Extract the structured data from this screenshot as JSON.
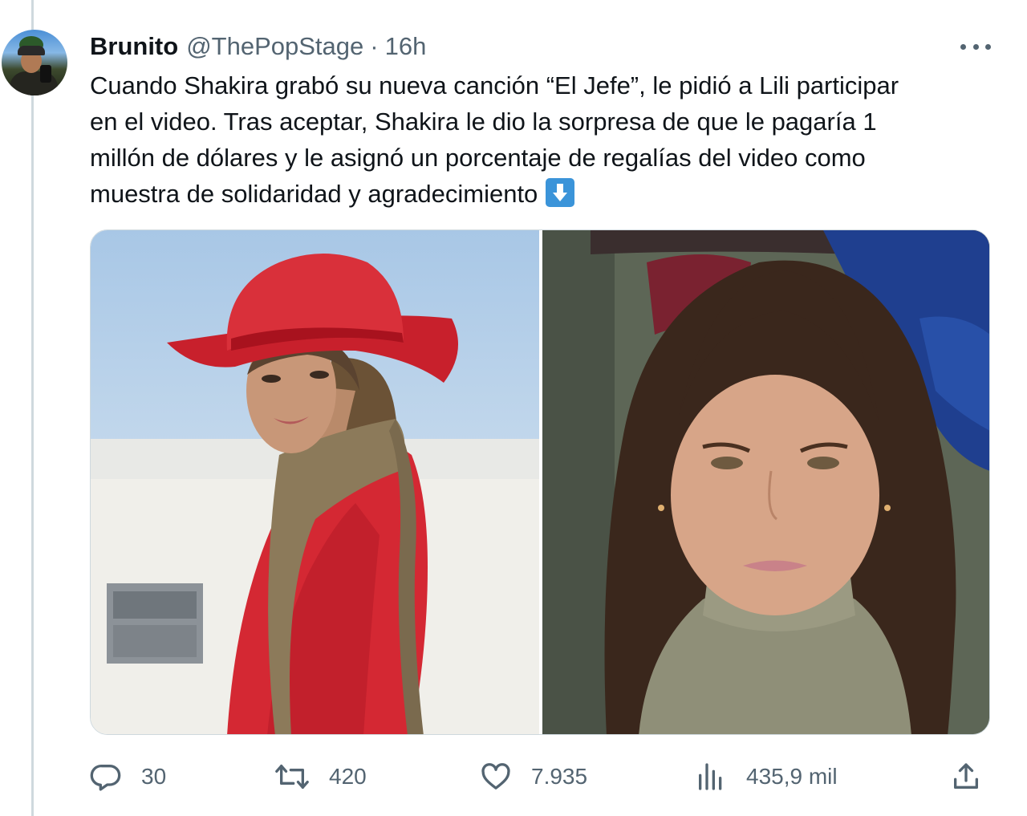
{
  "tweet": {
    "display_name": "Brunito",
    "handle": "@ThePopStage",
    "separator": "·",
    "time": "16h",
    "text_lines": [
      "Cuando Shakira grabó su nueva canción “El Jefe”, le pidió a Lili participar",
      "en el video. Tras aceptar, Shakira le dio la sorpresa de que le pagaría 1",
      "millón de dólares y le asignó un porcentaje de regalías del video como",
      "muestra de solidaridad y agradecimiento"
    ],
    "text_emoji": "arrow-down-emoji",
    "media": [
      {
        "icon": "photo-woman-red-cowboy-hat"
      },
      {
        "icon": "photo-woman-portrait"
      }
    ]
  },
  "actions": {
    "replies": {
      "icon": "reply-icon",
      "count": "30"
    },
    "retweets": {
      "icon": "retweet-icon",
      "count": "420"
    },
    "likes": {
      "icon": "heart-icon",
      "count": "7.935"
    },
    "views": {
      "icon": "views-icon",
      "count": "435,9 mil"
    },
    "share": {
      "icon": "share-icon"
    }
  },
  "colors": {
    "text": "#0f1419",
    "secondary": "#536471",
    "thread_line": "#cfd9de",
    "emoji_blue": "#3b94d9"
  }
}
